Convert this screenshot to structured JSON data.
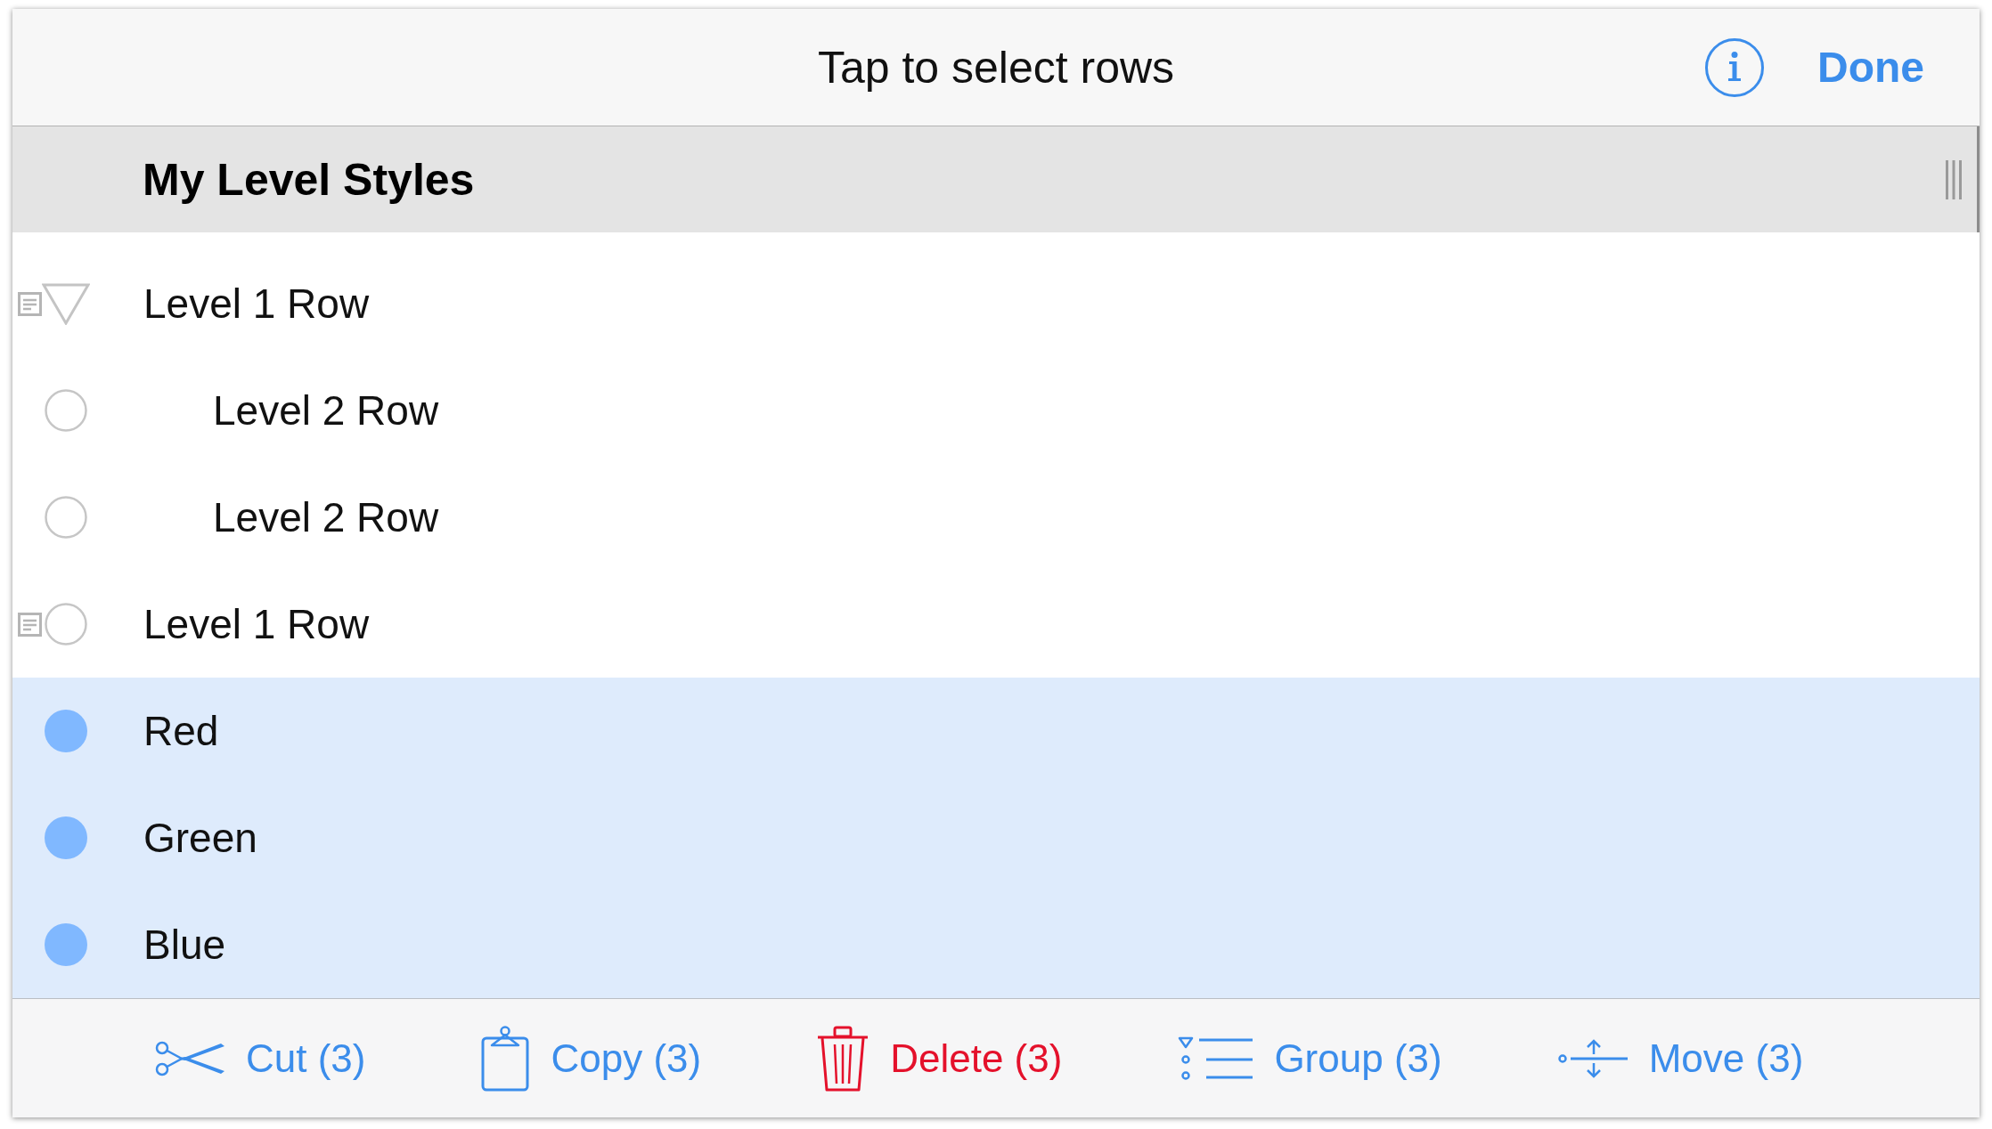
{
  "navigation_bar": {
    "title": "Tap to select rows",
    "done_button": "Done"
  },
  "column_header": {
    "title": "My Level Styles"
  },
  "rows": [
    {
      "label": "Level 1 Row",
      "has_note": true,
      "selected": false,
      "expanded": true,
      "children": [
        {
          "label": "Level 2 Row",
          "has_note": false,
          "selected": false
        },
        {
          "label": "Level 2 Row",
          "has_note": false,
          "selected": false
        }
      ]
    },
    {
      "label": "Level 1 Row",
      "has_note": true,
      "selected": false
    },
    {
      "label": "Red",
      "has_note": false,
      "selected": true
    },
    {
      "label": "Green",
      "has_note": false,
      "selected": true
    },
    {
      "label": "Blue",
      "has_note": false,
      "selected": true
    }
  ],
  "toolbar": [
    {
      "kind": "cut",
      "label": "Cut (3)"
    },
    {
      "kind": "copy",
      "label": "Copy (3)"
    },
    {
      "kind": "delete",
      "label": "Delete (3)"
    },
    {
      "kind": "group",
      "label": "Group (3)"
    },
    {
      "kind": "move",
      "label": "Move (3)"
    }
  ]
}
